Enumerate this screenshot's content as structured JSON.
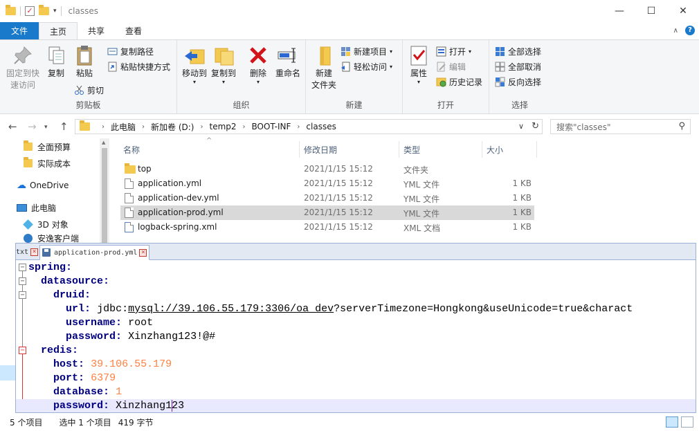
{
  "window": {
    "title": "classes",
    "controls": {
      "minimize": "—",
      "maximize": "☐",
      "close": "✕"
    }
  },
  "ribbon_tabs": [
    "文件",
    "主页",
    "共享",
    "查看"
  ],
  "ribbon": {
    "clipboard": {
      "label": "剪贴板",
      "pin_line1": "固定到快",
      "pin_line2": "速访问",
      "copy": "复制",
      "paste": "粘贴",
      "copy_path": "复制路径",
      "paste_shortcut": "粘贴快捷方式",
      "cut": "剪切"
    },
    "organize": {
      "label": "组织",
      "move_to": "移动到",
      "copy_to": "复制到",
      "delete": "删除",
      "rename": "重命名"
    },
    "new": {
      "label": "新建",
      "new_folder_line1": "新建",
      "new_folder_line2": "文件夹",
      "new_item": "新建项目",
      "easy_access": "轻松访问"
    },
    "open": {
      "label": "打开",
      "properties": "属性",
      "open": "打开",
      "edit": "编辑",
      "history": "历史记录"
    },
    "select": {
      "label": "选择",
      "select_all": "全部选择",
      "select_none": "全部取消",
      "invert": "反向选择"
    }
  },
  "address": {
    "crumbs": [
      "此电脑",
      "新加卷 (D:)",
      "temp2",
      "BOOT-INF",
      "classes"
    ],
    "search_placeholder": "搜索\"classes\""
  },
  "nav_pane": {
    "items": [
      "全面预算",
      "实际成本",
      "OneDrive",
      "此电脑",
      "3D 对象",
      "安逸客户端"
    ]
  },
  "file_list": {
    "columns": [
      "名称",
      "修改日期",
      "类型",
      "大小"
    ],
    "rows": [
      {
        "name": "top",
        "date": "2021/1/15 15:12",
        "type": "文件夹",
        "size": "",
        "icon": "folder"
      },
      {
        "name": "application.yml",
        "date": "2021/1/15 15:12",
        "type": "YML 文件",
        "size": "1 KB",
        "icon": "file"
      },
      {
        "name": "application-dev.yml",
        "date": "2021/1/15 15:12",
        "type": "YML 文件",
        "size": "1 KB",
        "icon": "file"
      },
      {
        "name": "application-prod.yml",
        "date": "2021/1/15 15:12",
        "type": "YML 文件",
        "size": "1 KB",
        "icon": "file",
        "selected": true
      },
      {
        "name": "logback-spring.xml",
        "date": "2021/1/15 15:12",
        "type": "XML 文档",
        "size": "1 KB",
        "icon": "xml-file"
      }
    ]
  },
  "editor": {
    "tabs": [
      "txt",
      "application-prod.yml"
    ],
    "lines": {
      "l1_key": "spring",
      "l2_key": "datasource",
      "l3_key": "druid",
      "l4_key": "url",
      "l4_val_scheme": "jdbc:",
      "l4_val_link": "mysql://39.106.55.179:3306/oa_dev",
      "l4_val_rest": "?serverTimezone=Hongkong&useUnicode=true&charact",
      "l5_key": "username",
      "l5_val": "root",
      "l6_key": "password",
      "l6_val": "Xinzhang123!@#",
      "l7_key": "redis",
      "l8_key": "host",
      "l8_val": "39.106.55.179",
      "l9_key": "port",
      "l9_val": "6379",
      "l10_key": "database",
      "l10_val": "1",
      "l11_key": "password",
      "l11_val": "Xinzhang123"
    }
  },
  "status": {
    "count": "5 个项目",
    "selection": "选中 1 个项目",
    "bytes": "419 字节"
  },
  "colors": {
    "accent": "#1979ca",
    "selected_row": "#d9d9d9",
    "yaml_key": "#000080",
    "yaml_number": "#ff8040"
  }
}
